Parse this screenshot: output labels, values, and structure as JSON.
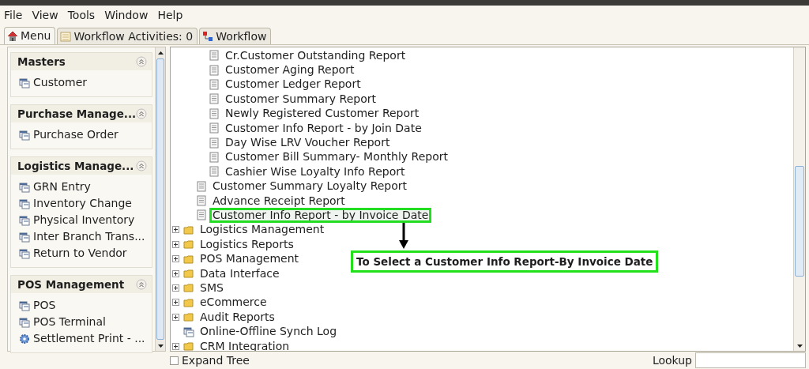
{
  "menu_bar": [
    "File",
    "View",
    "Tools",
    "Window",
    "Help"
  ],
  "tabs": [
    {
      "label": "Menu",
      "kind": "home",
      "selected": true
    },
    {
      "label": "Workflow Activities: 0",
      "kind": "list",
      "selected": false
    },
    {
      "label": "Workflow",
      "kind": "flow",
      "selected": false
    }
  ],
  "sidebar": {
    "sections": [
      {
        "title": "Masters",
        "expanded": true,
        "items": [
          {
            "label": "Customer",
            "kind": "form"
          }
        ]
      },
      {
        "title": "Purchase Manage...",
        "expanded": true,
        "items": [
          {
            "label": "Purchase Order",
            "kind": "form"
          }
        ]
      },
      {
        "title": "Logistics Manage...",
        "expanded": true,
        "items": [
          {
            "label": "GRN Entry",
            "kind": "form"
          },
          {
            "label": "Inventory Change",
            "kind": "form"
          },
          {
            "label": "Physical Inventory",
            "kind": "form"
          },
          {
            "label": "Inter Branch Trans...",
            "kind": "form"
          },
          {
            "label": "Return to Vendor",
            "kind": "form"
          }
        ]
      },
      {
        "title": "POS Management",
        "expanded": true,
        "items": [
          {
            "label": "POS",
            "kind": "form"
          },
          {
            "label": "POS Terminal",
            "kind": "form"
          },
          {
            "label": "Settlement Print - ...",
            "kind": "gear"
          }
        ]
      }
    ]
  },
  "tree": {
    "items": [
      {
        "children": [
          {
            "children": [
              {
                "label": "Cr.Customer Outstanding Report",
                "kind": "report",
                "selected": false
              },
              {
                "label": "Customer Aging Report",
                "kind": "report",
                "selected": false
              },
              {
                "label": "Customer Ledger Report",
                "kind": "report",
                "selected": false
              },
              {
                "label": "Customer Summary Report",
                "kind": "report",
                "selected": false
              },
              {
                "label": "Newly Registered Customer Report",
                "kind": "report",
                "selected": false
              },
              {
                "label": "Customer Info Report - by Join Date",
                "kind": "report",
                "selected": false
              },
              {
                "label": "Day Wise LRV Voucher Report",
                "kind": "report",
                "selected": false
              },
              {
                "label": "Customer Bill Summary- Monthly Report",
                "kind": "report",
                "selected": false
              },
              {
                "label": "Cashier Wise Loyalty Info Report",
                "kind": "report",
                "selected": false
              }
            ]
          },
          {
            "label": "Customer Summary Loyalty Report",
            "kind": "report",
            "selected": false
          },
          {
            "label": "Advance Receipt Report",
            "kind": "report",
            "selected": false
          },
          {
            "label": "Customer Info Report - by Invoice Date",
            "kind": "report",
            "selected": true
          }
        ]
      },
      {
        "label": "Logistics Management",
        "kind": "folder",
        "expanded": false,
        "selected": false
      },
      {
        "label": "Logistics Reports",
        "kind": "folder",
        "expanded": false,
        "selected": false
      },
      {
        "label": "POS Management",
        "kind": "folder",
        "expanded": false,
        "selected": false
      },
      {
        "label": "Data Interface",
        "kind": "folder",
        "expanded": false,
        "selected": false
      },
      {
        "label": "SMS",
        "kind": "folder",
        "expanded": false,
        "selected": false
      },
      {
        "label": "eCommerce",
        "kind": "folder",
        "expanded": false,
        "selected": false
      },
      {
        "label": "Audit Reports",
        "kind": "folder",
        "expanded": false,
        "selected": false
      },
      {
        "label": "Online-Offline Synch Log",
        "kind": "form",
        "selected": false
      },
      {
        "label": "CRM Integration",
        "kind": "folder",
        "expanded": false,
        "selected": false
      }
    ]
  },
  "callout": {
    "text": "To Select a Customer Info Report-By Invoice Date"
  },
  "footer": {
    "expand_tree": {
      "label": "Expand Tree",
      "checked": false
    },
    "lookup": {
      "label": "Lookup"
    }
  }
}
